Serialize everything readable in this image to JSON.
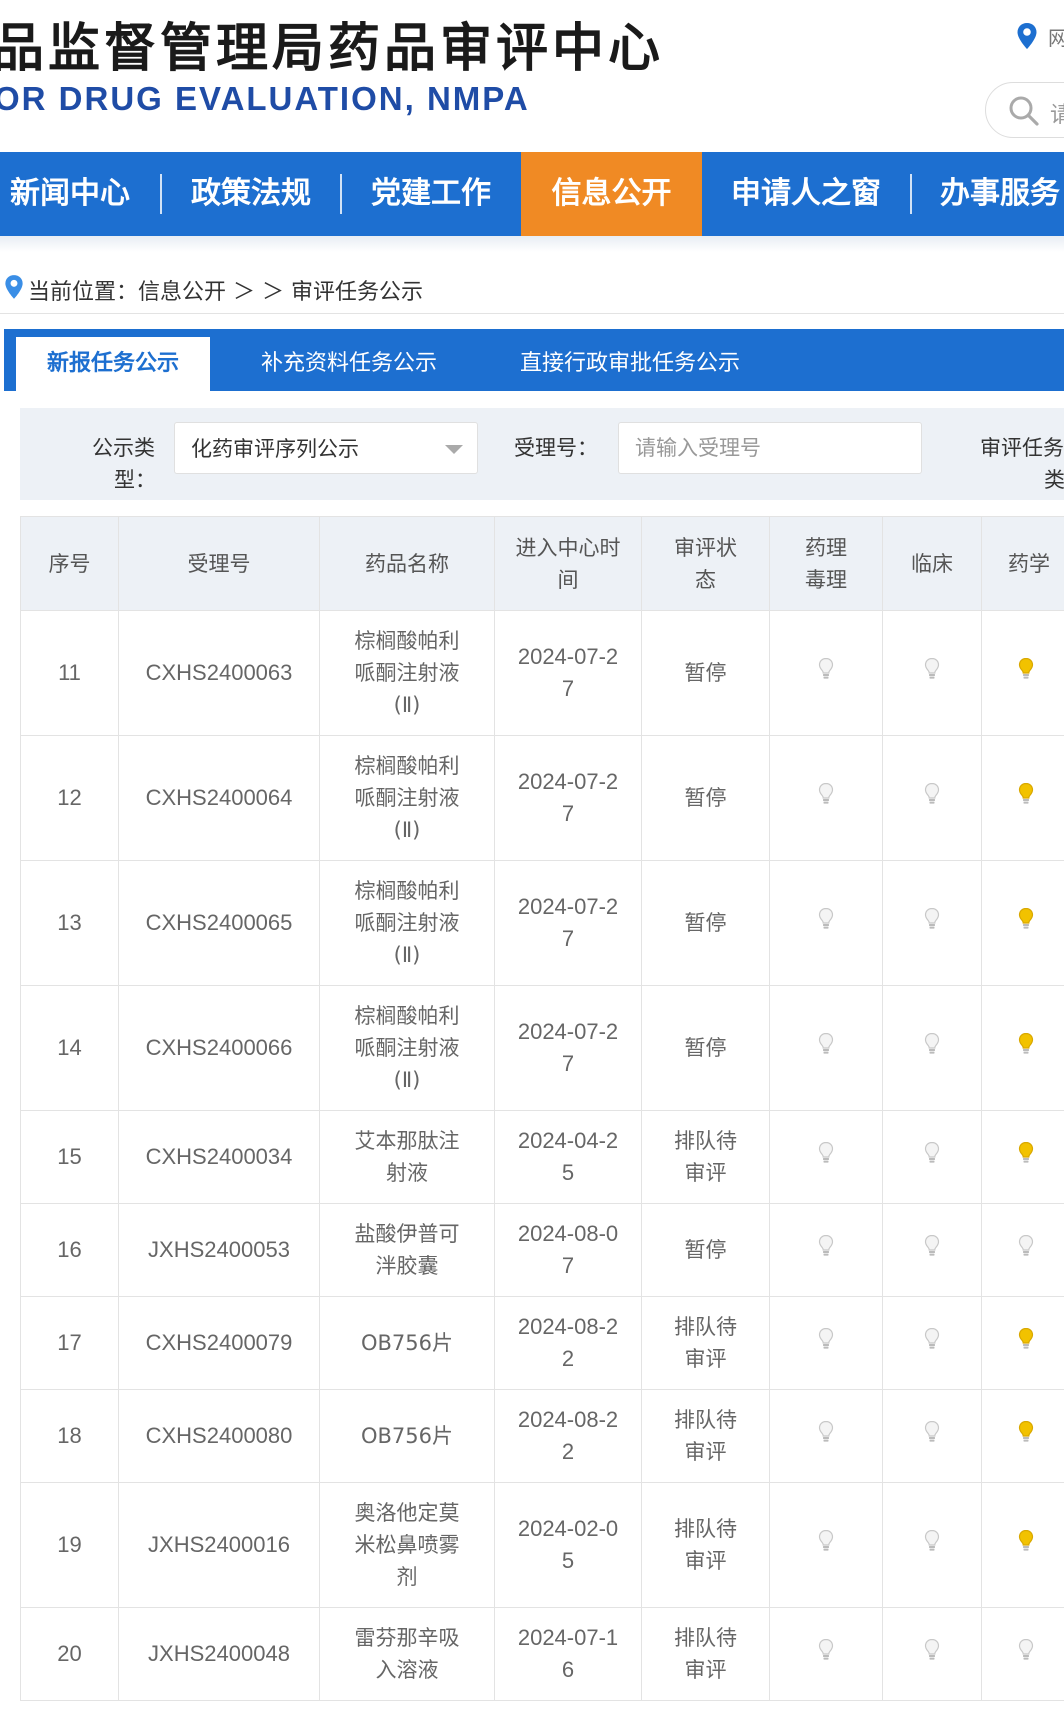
{
  "header": {
    "title_cn": "品监督管理局药品审评中心",
    "title_en": "OR DRUG EVALUATION, NMPA",
    "location_text": "网",
    "search_placeholder": "请"
  },
  "nav": {
    "items": [
      {
        "label": "新闻中心",
        "active": false
      },
      {
        "label": "政策法规",
        "active": false
      },
      {
        "label": "党建工作",
        "active": false
      },
      {
        "label": "信息公开",
        "active": true
      },
      {
        "label": "申请人之窗",
        "active": false
      },
      {
        "label": "办事服务",
        "active": false
      }
    ]
  },
  "breadcrumb": {
    "prefix": "当前位置：",
    "path": "信息公开 ＞ ＞ 审评任务公示"
  },
  "tabs": [
    {
      "label": "新报任务公示",
      "active": true
    },
    {
      "label": "补充资料任务公示",
      "active": false
    },
    {
      "label": "直接行政审批任务公示",
      "active": false
    }
  ],
  "filters": {
    "type_label_1": "公示类",
    "type_label_2": "型：",
    "type_value": "化药审评序列公示",
    "accept_label": "受理号：",
    "accept_placeholder": "请输入受理号",
    "task_label_1": "审评任务",
    "task_label_2": "类"
  },
  "table": {
    "headers": [
      "序号",
      "受理号",
      "药品名称",
      "进入中心时间",
      "审评状态",
      "药理毒理",
      "临床",
      "药学"
    ],
    "rows": [
      {
        "no": "11",
        "acc": "CXHS2400063",
        "name": "棕榈酸帕利哌酮注射液(Ⅱ)",
        "date": "2024-07-27",
        "status": "暂停",
        "pharm_tox": false,
        "clinical": false,
        "pharmacy": true
      },
      {
        "no": "12",
        "acc": "CXHS2400064",
        "name": "棕榈酸帕利哌酮注射液(Ⅱ)",
        "date": "2024-07-27",
        "status": "暂停",
        "pharm_tox": false,
        "clinical": false,
        "pharmacy": true
      },
      {
        "no": "13",
        "acc": "CXHS2400065",
        "name": "棕榈酸帕利哌酮注射液(Ⅱ)",
        "date": "2024-07-27",
        "status": "暂停",
        "pharm_tox": false,
        "clinical": false,
        "pharmacy": true
      },
      {
        "no": "14",
        "acc": "CXHS2400066",
        "name": "棕榈酸帕利哌酮注射液(Ⅱ)",
        "date": "2024-07-27",
        "status": "暂停",
        "pharm_tox": false,
        "clinical": false,
        "pharmacy": true
      },
      {
        "no": "15",
        "acc": "CXHS2400034",
        "name": "艾本那肽注射液",
        "date": "2024-04-25",
        "status": "排队待审评",
        "pharm_tox": false,
        "clinical": false,
        "pharmacy": true
      },
      {
        "no": "16",
        "acc": "JXHS2400053",
        "name": "盐酸伊普可泮胶囊",
        "date": "2024-08-07",
        "status": "暂停",
        "pharm_tox": false,
        "clinical": false,
        "pharmacy": false
      },
      {
        "no": "17",
        "acc": "CXHS2400079",
        "name": "OB756片",
        "date": "2024-08-22",
        "status": "排队待审评",
        "pharm_tox": false,
        "clinical": false,
        "pharmacy": true
      },
      {
        "no": "18",
        "acc": "CXHS2400080",
        "name": "OB756片",
        "date": "2024-08-22",
        "status": "排队待审评",
        "pharm_tox": false,
        "clinical": false,
        "pharmacy": true
      },
      {
        "no": "19",
        "acc": "JXHS2400016",
        "name": "奥洛他定莫米松鼻喷雾剂",
        "date": "2024-02-05",
        "status": "排队待审评",
        "pharm_tox": false,
        "clinical": false,
        "pharmacy": true
      },
      {
        "no": "20",
        "acc": "JXHS2400048",
        "name": "雷芬那辛吸入溶液",
        "date": "2024-07-16",
        "status": "排队待审评",
        "pharm_tox": false,
        "clinical": false,
        "pharmacy": false
      }
    ]
  },
  "colors": {
    "nav_blue": "#1d6fd0",
    "nav_active": "#f08a24",
    "title_en": "#1f4ca6",
    "bulb_on": "#f2c200",
    "bulb_off": "#c8c8c8"
  }
}
